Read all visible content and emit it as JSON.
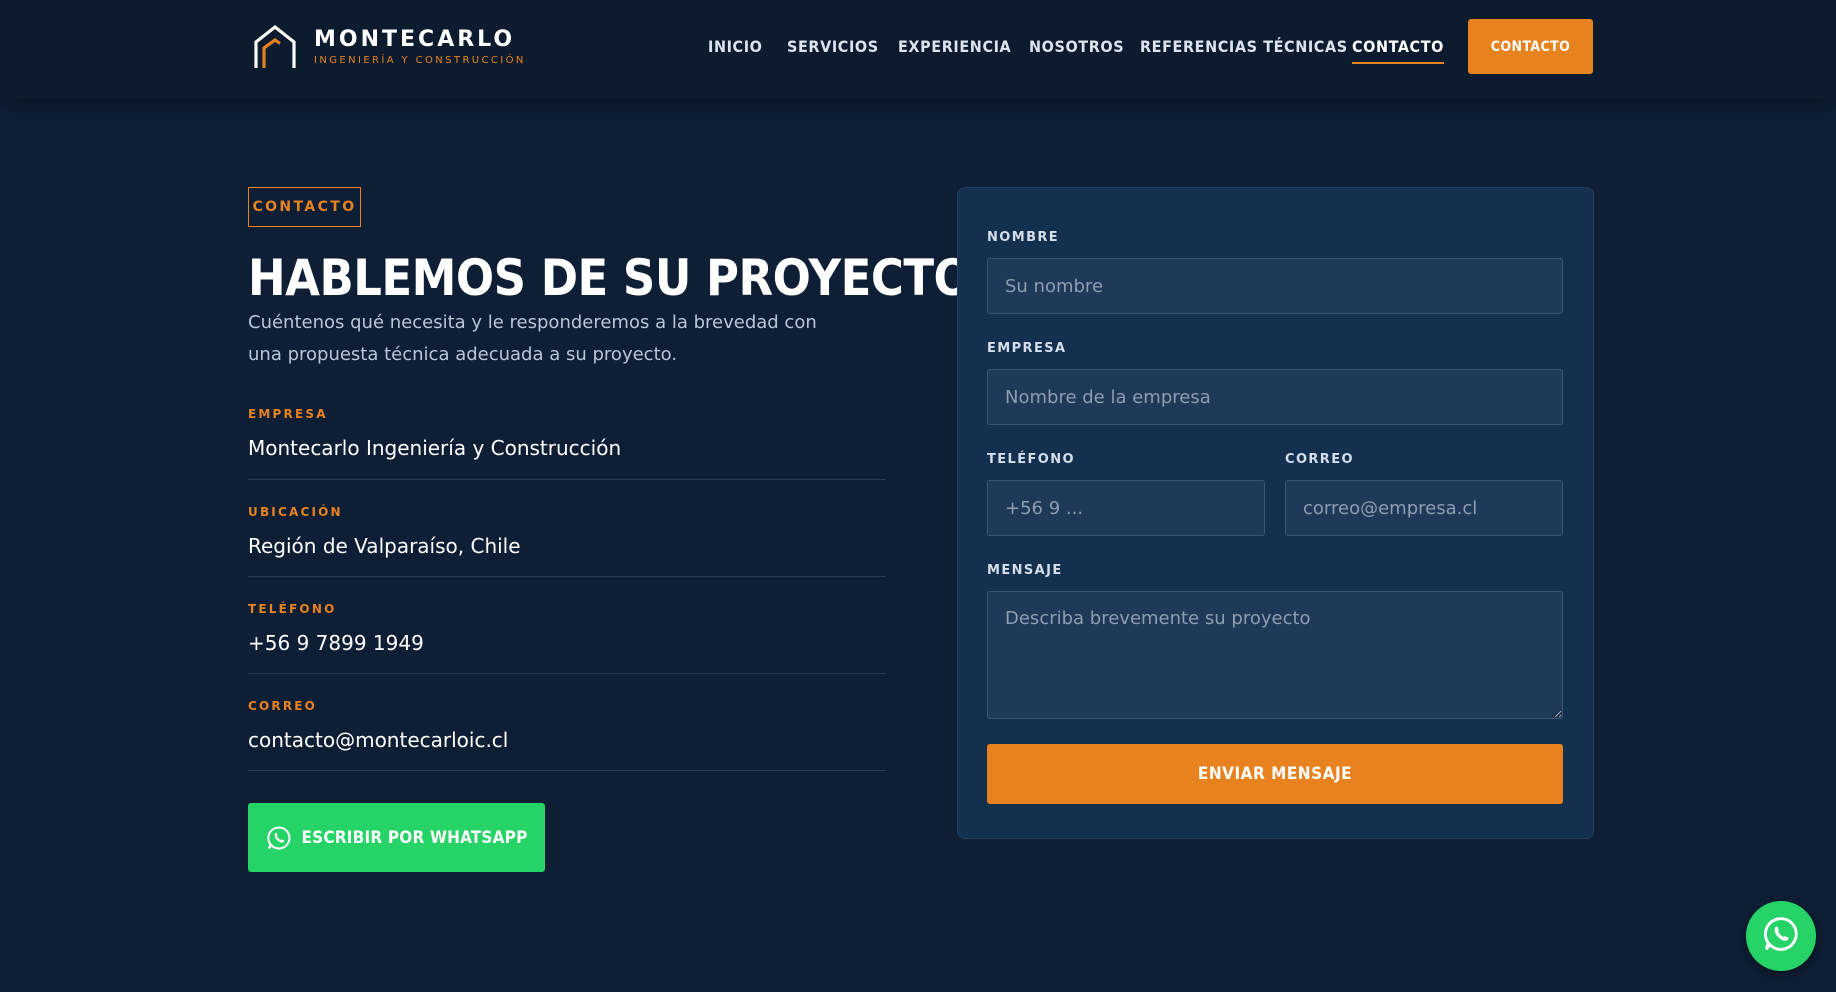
{
  "brand": {
    "name": "MONTECARLO",
    "tagline": "INGENIERÍA Y CONSTRUCCIÓN"
  },
  "nav": {
    "items": [
      {
        "label": "INICIO"
      },
      {
        "label": "SERVICIOS"
      },
      {
        "label": "EXPERIENCIA"
      },
      {
        "label": "NOSOTROS"
      },
      {
        "label": "REFERENCIAS TÉCNICAS"
      },
      {
        "label": "CONTACTO",
        "active": true
      }
    ],
    "cta_label": "CONTACTO"
  },
  "contact": {
    "eyebrow": "CONTACTO",
    "title": "HABLEMOS DE SU PROYECTO",
    "lead": "Cuéntenos qué necesita y le responderemos a la brevedad con una propuesta técnica adecuada a su proyecto.",
    "info": [
      {
        "label": "EMPRESA",
        "value": "Montecarlo Ingeniería y Construcción"
      },
      {
        "label": "UBICACIÓN",
        "value": "Región de Valparaíso, Chile"
      },
      {
        "label": "TELÉFONO",
        "value": "+56 9 7899 1949"
      },
      {
        "label": "CORREO",
        "value": "contacto@montecarloic.cl"
      }
    ],
    "whatsapp_label": "ESCRIBIR POR WHATSAPP"
  },
  "form": {
    "nombre": {
      "label": "NOMBRE",
      "placeholder": "Su nombre",
      "value": ""
    },
    "empresa": {
      "label": "EMPRESA",
      "placeholder": "Nombre de la empresa",
      "value": ""
    },
    "telefono": {
      "label": "TELÉFONO",
      "placeholder": "+56 9 ...",
      "value": ""
    },
    "correo": {
      "label": "CORREO",
      "placeholder": "correo@empresa.cl",
      "value": ""
    },
    "mensaje": {
      "label": "MENSAJE",
      "placeholder": "Describa brevemente su proyecto",
      "value": ""
    },
    "submit_label": "ENVIAR MENSAJE"
  },
  "colors": {
    "accent": "#e8821f",
    "background": "#0e1f35",
    "whatsapp": "#25d366"
  },
  "icons": {
    "logo": "house-roof-icon",
    "whatsapp": "whatsapp-icon",
    "floating": "whatsapp-icon"
  }
}
